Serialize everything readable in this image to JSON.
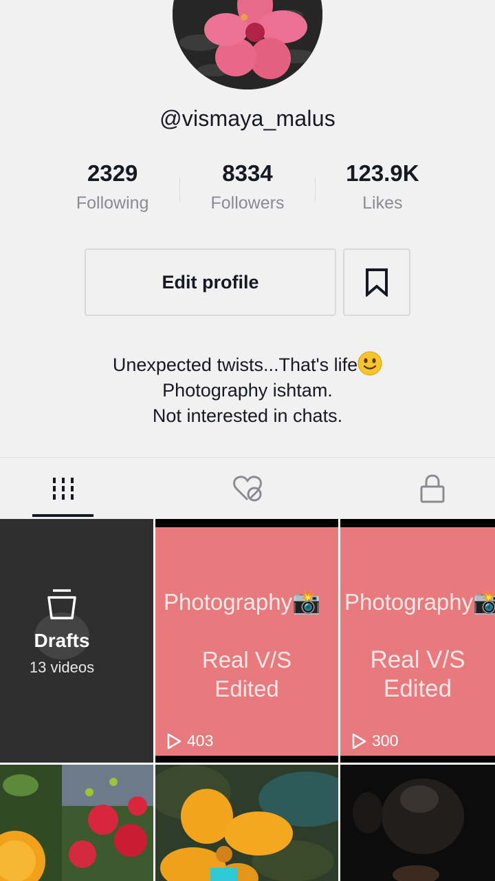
{
  "profile": {
    "username": "@vismaya_malus",
    "stats": [
      {
        "value": "2329",
        "label": "Following"
      },
      {
        "value": "8334",
        "label": "Followers"
      },
      {
        "value": "123.9K",
        "label": "Likes"
      }
    ],
    "edit_profile_label": "Edit profile",
    "bio_lines": [
      "Unexpected twists...That's life",
      "Photography ishtam.",
      "Not interested in chats."
    ]
  },
  "tabs": [
    {
      "icon": "grid-icon",
      "active": true
    },
    {
      "icon": "liked-hidden-icon",
      "active": false
    },
    {
      "icon": "lock-icon",
      "active": false
    }
  ],
  "grid": {
    "drafts": {
      "title": "Drafts",
      "count": "13 videos"
    },
    "videos": [
      {
        "title": "Photography📸",
        "subtitle_1": "Real  V/S",
        "subtitle_2": "Edited",
        "views": "403"
      },
      {
        "title": "Photography📸",
        "subtitle_1": "Real  V/S",
        "subtitle_2": "Edited",
        "views": "300"
      }
    ]
  },
  "colors": {
    "background": "#f1f1f2",
    "text": "#161823",
    "muted": "#8a8b91",
    "tile_pink": "#e8797d"
  }
}
